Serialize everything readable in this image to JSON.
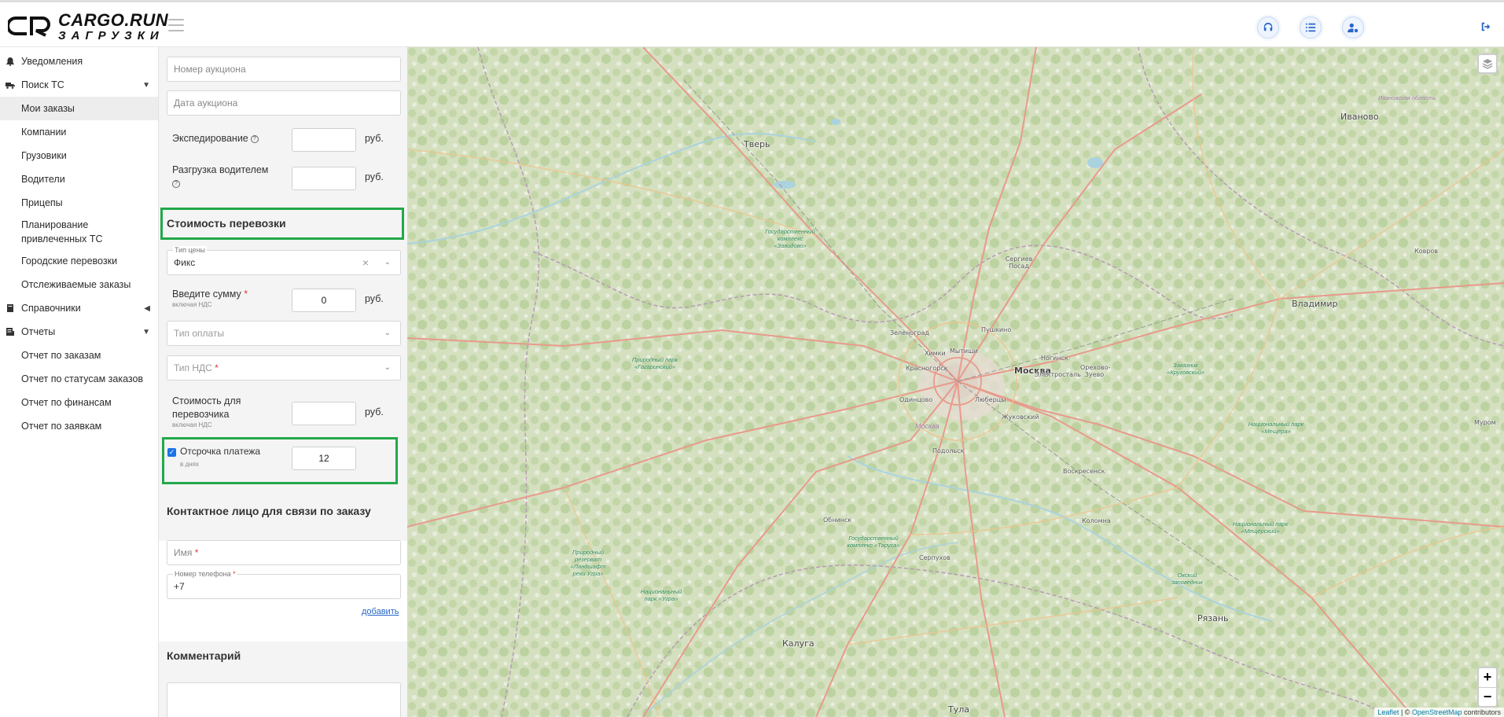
{
  "header": {
    "logo_line1": "CARGO.RUN",
    "logo_line2": "ЗАГРУЗКИ",
    "icons": [
      "headset-icon",
      "list-icon",
      "user-settings-icon",
      "logout-icon"
    ],
    "accent_color": "#2766c9"
  },
  "sidebar": {
    "items": [
      {
        "label": "Уведомления",
        "icon": "bell-icon"
      },
      {
        "label": "Поиск ТС",
        "icon": "truck-icon",
        "expanded": true
      },
      {
        "label": "Мои заказы",
        "active": true
      },
      {
        "label": "Компании"
      },
      {
        "label": "Грузовики"
      },
      {
        "label": "Водители"
      },
      {
        "label": "Прицепы"
      },
      {
        "label": "Планирование привлеченных ТС"
      },
      {
        "label": "Городские перевозки"
      },
      {
        "label": "Отслеживаемые заказы"
      },
      {
        "label": "Справочники",
        "icon": "book-icon",
        "expanded": false
      },
      {
        "label": "Отчеты",
        "icon": "report-icon",
        "expanded": true
      },
      {
        "label": "Отчет по заказам"
      },
      {
        "label": "Отчет по статусам заказов"
      },
      {
        "label": "Отчет по финансам"
      },
      {
        "label": "Отчет по заявкам"
      }
    ]
  },
  "form": {
    "auction_number_placeholder": "Номер аукциона",
    "auction_date_placeholder": "Дата аукциона",
    "forwarding_label": "Экспедирование",
    "forwarding_value": "",
    "unloading_label": "Разгрузка водителем",
    "unloading_value": "",
    "unit": "руб.",
    "cost_section_title": "Стоимость перевозки",
    "price_type_label": "Тип цены",
    "price_type_value": "Фикс",
    "amount_label": "Введите сумму",
    "amount_sub": "включая НДС",
    "amount_value": "0",
    "payment_type_placeholder": "Тип оплаты",
    "vat_type_placeholder": "Тип НДС",
    "carrier_cost_label": "Стоимость для перевозчика",
    "carrier_cost_sub": "включая НДС",
    "carrier_cost_value": "",
    "deferral_label": "Отсрочка платежа",
    "deferral_sub": "в днях",
    "deferral_checked": true,
    "deferral_value": "12",
    "contact_section_title": "Контактное лицо для связи по заказу",
    "name_placeholder": "Имя",
    "phone_label": "Номер телефона",
    "phone_value": "+7",
    "add_link": "добавить",
    "comment_section_title": "Комментарий",
    "required_mark": "*",
    "highlight_color": "#22a84a"
  },
  "map": {
    "cities": [
      {
        "name": "Тверь"
      },
      {
        "name": "Иваново"
      },
      {
        "name": "Владимир"
      },
      {
        "name": "Москва"
      },
      {
        "name": "Калуга"
      },
      {
        "name": "Рязань"
      },
      {
        "name": "Тула"
      },
      {
        "name": "Сергиев Посад"
      },
      {
        "name": "Зеленоград"
      },
      {
        "name": "Пушкино"
      },
      {
        "name": "Химки"
      },
      {
        "name": "Мытищи"
      },
      {
        "name": "Красногорск"
      },
      {
        "name": "Ногинск"
      },
      {
        "name": "Электросталь"
      },
      {
        "name": "Орехово-Зуево"
      },
      {
        "name": "Одинцово"
      },
      {
        "name": "Люберцы"
      },
      {
        "name": "Жуковский"
      },
      {
        "name": "Подольск"
      },
      {
        "name": "Воскресенск"
      },
      {
        "name": "Обнинск"
      },
      {
        "name": "Серпухов"
      },
      {
        "name": "Коломна"
      },
      {
        "name": "Ковров"
      },
      {
        "name": "Муром"
      }
    ],
    "region_labels": [
      "Ивановская область",
      "Москва"
    ],
    "parks": [
      "Государственный комплекс «Завидово»",
      "Природный парк «Гагаринский»",
      "Заказник «Круговский»",
      "Национальный парк «Мещёра»",
      "Национальный парк «Мещёрский»",
      "Государственный комплекс «Таруса»",
      "Природный резерват «Ландшафт реки Угра»",
      "Национальный парк «Угра»",
      "Окский заповедник"
    ],
    "zoom_in": "+",
    "zoom_out": "−",
    "attribution_leaflet": "Leaflet",
    "attribution_sep": " | © ",
    "attribution_osm": "OpenStreetMap",
    "attribution_tail": " contributors"
  }
}
